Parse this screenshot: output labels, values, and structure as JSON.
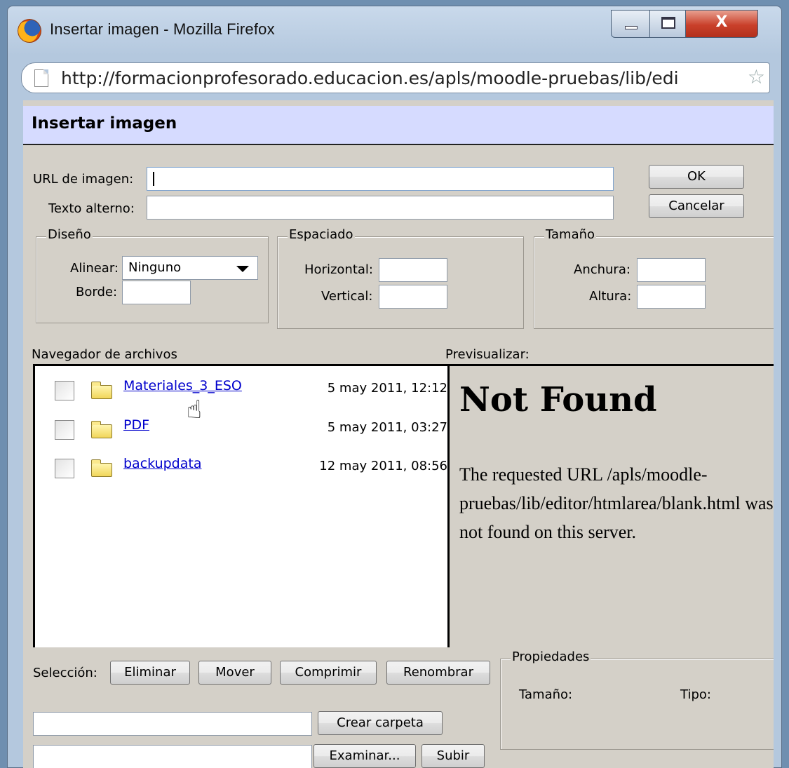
{
  "window": {
    "title": "Insertar imagen - Mozilla Firefox",
    "url": "http://formacionprofesorado.educacion.es/apls/moodle-pruebas/lib/edi",
    "controls": {
      "minimize": "minimize-icon",
      "maximize": "maximize-icon",
      "close": "X"
    }
  },
  "dialog": {
    "title": "Insertar imagen",
    "url_label": "URL de imagen:",
    "url_value": "",
    "alt_label": "Texto alterno:",
    "alt_value": "",
    "ok_label": "OK",
    "cancel_label": "Cancelar"
  },
  "layout_group": {
    "legend": "Diseño",
    "align_label": "Alinear:",
    "align_value": "Ninguno",
    "border_label": "Borde:",
    "border_value": ""
  },
  "spacing_group": {
    "legend": "Espaciado",
    "horizontal_label": "Horizontal:",
    "horizontal_value": "",
    "vertical_label": "Vertical:",
    "vertical_value": ""
  },
  "size_group": {
    "legend": "Tamaño",
    "width_label": "Anchura:",
    "width_value": "",
    "height_label": "Altura:",
    "height_value": ""
  },
  "file_browser": {
    "label": "Navegador de archivos",
    "files": [
      {
        "name": "Materiales_3_ESO",
        "date": "5 may 2011, 12:12"
      },
      {
        "name": "PDF",
        "date": "5 may 2011, 03:27"
      },
      {
        "name": "backupdata",
        "date": "12 may 2011, 08:56"
      }
    ]
  },
  "preview": {
    "label": "Previsualizar:",
    "heading": "Not Found",
    "message": "The requested URL /apls/moodle-pruebas/lib/editor/htmlarea/blank.html was not found on this server."
  },
  "selection": {
    "label": "Selección:",
    "delete_label": "Eliminar",
    "move_label": "Mover",
    "compress_label": "Comprimir",
    "rename_label": "Renombrar"
  },
  "properties": {
    "legend": "Propiedades",
    "size_label": "Tamaño:",
    "type_label": "Tipo:"
  },
  "folder_tools": {
    "create_folder_value": "",
    "create_folder_label": "Crear carpeta",
    "upload_value": "",
    "browse_label": "Examinar...",
    "upload_label": "Subir"
  },
  "colors": {
    "dialog_bg": "#d4d0c8",
    "header_bg": "#d6dbff",
    "link": "#0000cc",
    "close_button": "#c9402a"
  }
}
